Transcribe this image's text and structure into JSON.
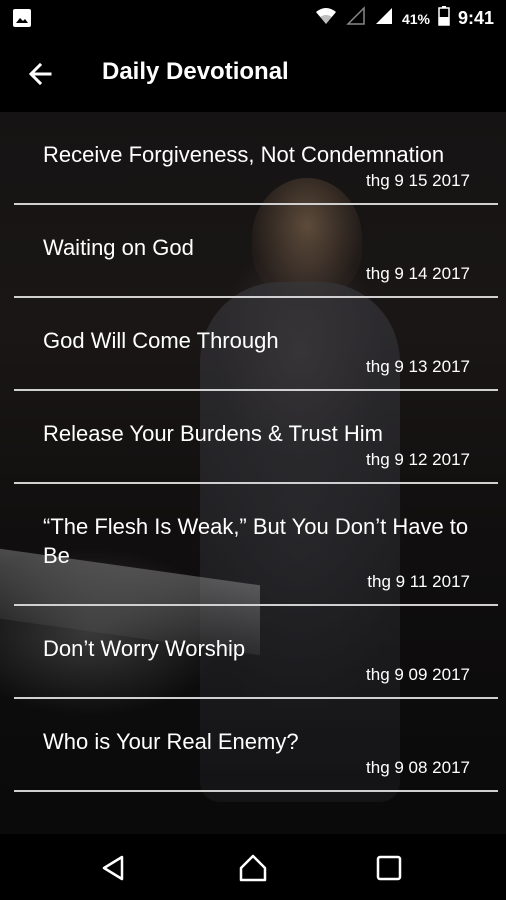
{
  "status": {
    "battery_percent": "41%",
    "time": "9:41",
    "icons": [
      "image-icon",
      "wifi-icon",
      "signal-empty-icon",
      "signal-icon",
      "battery-icon"
    ]
  },
  "appbar": {
    "title": "Daily Devotional",
    "back_icon": "arrow-left-icon"
  },
  "devotionals": [
    {
      "title": "Receive Forgiveness, Not Condemnation",
      "date": "thg 9 15 2017"
    },
    {
      "title": "Waiting on God",
      "date": "thg 9 14 2017"
    },
    {
      "title": "God Will Come Through",
      "date": "thg 9 13 2017"
    },
    {
      "title": "Release Your Burdens & Trust Him",
      "date": "thg 9 12 2017"
    },
    {
      "title": "“The Flesh Is Weak,” But You Don’t Have to Be",
      "date": "thg 9 11 2017"
    },
    {
      "title": "Don’t Worry Worship",
      "date": "thg 9 09 2017"
    },
    {
      "title": "Who is Your Real Enemy?",
      "date": "thg 9 08 2017"
    }
  ],
  "navbar": {
    "icons": [
      "back-triangle-icon",
      "home-icon",
      "recents-square-icon"
    ]
  }
}
